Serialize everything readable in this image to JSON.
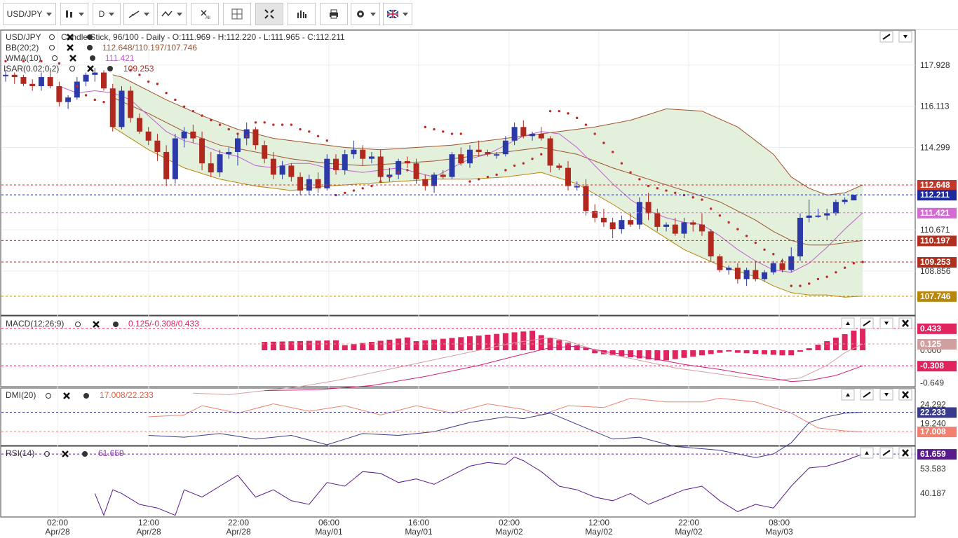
{
  "toolbar": {
    "symbol": "USD/JPY",
    "period": "D",
    "buttons": [
      "chart-type",
      "period",
      "draw",
      "indicators",
      "delete-all",
      "crosshair",
      "fullscreen",
      "studies",
      "print",
      "settings",
      "language"
    ]
  },
  "header": {
    "main": "USD/JPY",
    "main_desc": "Candle Stick, 96/100 - Daily - O:111.969 - H:112.220 - L:111.965 - C:112.211",
    "bb_name": "BB(20;2)",
    "bb_values": "112.648/110.197/107.746",
    "wma_name": "WMA(10)",
    "wma_value": "111.421",
    "sar_name": "ISAR(0.02;0.2)",
    "sar_value": "109.253",
    "macd_name": "MACD(12;26;9)",
    "macd_values": "0.125/-0.308/0.433",
    "dmi_name": "DMI(20)",
    "dmi_values": "17.008/22.233",
    "rsi_name": "RSI(14)",
    "rsi_value": "61.659"
  },
  "price_axis": [
    "117.928",
    "116.113",
    "114.299",
    "110.671",
    "108.856"
  ],
  "price_tags": [
    {
      "label": "112.648",
      "color": "#c0392b",
      "value": 112.648
    },
    {
      "label": "112.211",
      "color": "#1a2a9c",
      "value": 112.211
    },
    {
      "label": "111.421",
      "color": "#d46bd4",
      "value": 111.421
    },
    {
      "label": "110.197",
      "color": "#b03020",
      "value": 110.197
    },
    {
      "label": "109.253",
      "color": "#b03020",
      "value": 109.253
    },
    {
      "label": "107.746",
      "color": "#b8860b",
      "value": 107.746
    }
  ],
  "macd_axis": [
    "0.000",
    "-0.649"
  ],
  "macd_tags": [
    {
      "label": "0.433",
      "color": "#e0245e",
      "value": 0.433
    },
    {
      "label": "0.125",
      "color": "#d0a0a0",
      "value": 0.125
    },
    {
      "label": "-0.308",
      "color": "#e0245e",
      "value": -0.308
    }
  ],
  "dmi_axis": [
    "24.292",
    "19.240"
  ],
  "dmi_tags": [
    {
      "label": "22.233",
      "color": "#3a3a8c",
      "value": 22.233
    },
    {
      "label": "17.008",
      "color": "#f08070",
      "value": 17.008
    }
  ],
  "rsi_axis": [
    "53.583",
    "40.187"
  ],
  "rsi_tags": [
    {
      "label": "61.659",
      "color": "#5a1a8c",
      "value": 61.659
    }
  ],
  "time_axis": [
    {
      "time": "02:00",
      "date": "Apr/28"
    },
    {
      "time": "12:00",
      "date": "Apr/28"
    },
    {
      "time": "22:00",
      "date": "Apr/28"
    },
    {
      "time": "06:00",
      "date": "May/01"
    },
    {
      "time": "16:00",
      "date": "May/01"
    },
    {
      "time": "02:00",
      "date": "May/02"
    },
    {
      "time": "12:00",
      "date": "May/02"
    },
    {
      "time": "22:00",
      "date": "May/02"
    },
    {
      "time": "08:00",
      "date": "May/03"
    }
  ],
  "colors": {
    "bull": "#2b3aa8",
    "bear": "#b0281e",
    "band_fill": "#e3f0dc",
    "band_line": "#a0522d",
    "wma": "#c060d0",
    "sar": "#c0282a",
    "macd_bar": "#e0245e",
    "dmi_plus": "#f08070",
    "dmi_minus": "#3a3a8c",
    "rsi": "#5a1a8c"
  },
  "chart_data": {
    "type": "candlestick",
    "symbol": "USD/JPY",
    "x_labels": [
      "02:00 Apr/28",
      "12:00 Apr/28",
      "22:00 Apr/28",
      "06:00 May/01",
      "16:00 May/01",
      "02:00 May/02",
      "12:00 May/02",
      "22:00 May/02",
      "08:00 May/03"
    ],
    "ylim": [
      107.0,
      119.5
    ],
    "candles": [
      [
        117.5,
        117.7,
        117.2,
        117.5
      ],
      [
        117.5,
        117.6,
        117.1,
        117.4
      ],
      [
        117.4,
        117.5,
        117.0,
        117.1
      ],
      [
        117.1,
        117.3,
        116.8,
        117.0
      ],
      [
        117.0,
        117.6,
        116.8,
        117.4
      ],
      [
        117.4,
        117.8,
        116.9,
        117.0
      ],
      [
        117.0,
        117.2,
        116.1,
        116.3
      ],
      [
        116.3,
        116.6,
        116.0,
        116.5
      ],
      [
        116.5,
        117.4,
        116.4,
        117.2
      ],
      [
        117.2,
        117.6,
        117.0,
        117.5
      ],
      [
        117.5,
        117.8,
        117.2,
        117.6
      ],
      [
        117.6,
        117.7,
        116.8,
        116.9
      ],
      [
        116.9,
        117.1,
        115.0,
        115.2
      ],
      [
        115.2,
        117.0,
        115.1,
        116.8
      ],
      [
        116.8,
        117.0,
        115.4,
        115.6
      ],
      [
        115.6,
        115.8,
        114.9,
        115.0
      ],
      [
        115.0,
        115.2,
        114.4,
        114.6
      ],
      [
        114.6,
        114.9,
        113.7,
        114.1
      ],
      [
        114.1,
        114.4,
        112.6,
        112.9
      ],
      [
        112.9,
        114.9,
        112.7,
        114.7
      ],
      [
        114.7,
        115.2,
        114.3,
        115.0
      ],
      [
        115.0,
        115.3,
        114.5,
        114.7
      ],
      [
        114.7,
        115.0,
        113.3,
        113.6
      ],
      [
        113.6,
        114.1,
        113.0,
        113.2
      ],
      [
        113.2,
        114.2,
        113.0,
        114.0
      ],
      [
        114.0,
        114.3,
        113.8,
        114.1
      ],
      [
        114.1,
        114.9,
        113.5,
        114.7
      ],
      [
        114.7,
        115.4,
        114.4,
        115.1
      ],
      [
        115.1,
        115.2,
        114.2,
        114.4
      ],
      [
        114.4,
        114.6,
        113.6,
        113.8
      ],
      [
        113.8,
        114.1,
        112.9,
        113.1
      ],
      [
        113.1,
        113.7,
        112.9,
        113.5
      ],
      [
        113.5,
        113.6,
        112.8,
        113.0
      ],
      [
        113.0,
        113.2,
        112.2,
        112.4
      ],
      [
        112.4,
        113.1,
        112.2,
        112.9
      ],
      [
        112.9,
        113.2,
        112.3,
        112.5
      ],
      [
        112.5,
        114.0,
        112.4,
        113.8
      ],
      [
        113.8,
        114.0,
        113.1,
        113.3
      ],
      [
        113.3,
        114.2,
        113.1,
        114.0
      ],
      [
        114.0,
        114.6,
        113.8,
        114.2
      ],
      [
        114.2,
        114.4,
        113.5,
        113.8
      ],
      [
        113.8,
        114.1,
        113.6,
        113.9
      ],
      [
        113.9,
        114.2,
        112.8,
        113.0
      ],
      [
        113.0,
        113.4,
        112.8,
        113.1
      ],
      [
        113.1,
        113.8,
        112.9,
        113.7
      ],
      [
        113.7,
        113.9,
        113.4,
        113.6
      ],
      [
        113.6,
        113.8,
        112.7,
        112.9
      ],
      [
        112.9,
        113.1,
        112.4,
        112.6
      ],
      [
        112.6,
        113.2,
        112.3,
        113.1
      ],
      [
        113.1,
        113.3,
        112.9,
        113.0
      ],
      [
        113.0,
        114.1,
        112.9,
        114.0
      ],
      [
        114.0,
        114.3,
        113.5,
        113.6
      ],
      [
        113.6,
        114.4,
        113.4,
        114.2
      ],
      [
        114.2,
        114.6,
        113.9,
        114.1
      ],
      [
        114.1,
        114.2,
        113.9,
        114.0
      ],
      [
        114.0,
        114.1,
        113.8,
        114.0
      ],
      [
        114.0,
        114.8,
        113.9,
        114.6
      ],
      [
        114.6,
        115.4,
        114.4,
        115.2
      ],
      [
        115.2,
        115.5,
        114.7,
        114.8
      ],
      [
        114.8,
        115.0,
        114.6,
        114.9
      ],
      [
        114.9,
        115.2,
        114.6,
        114.7
      ],
      [
        114.7,
        114.8,
        113.2,
        113.5
      ],
      [
        113.5,
        113.6,
        113.3,
        113.4
      ],
      [
        113.4,
        113.7,
        112.4,
        112.6
      ],
      [
        112.6,
        112.8,
        112.4,
        112.6
      ],
      [
        112.6,
        112.9,
        111.3,
        111.5
      ],
      [
        111.5,
        111.8,
        111.0,
        111.2
      ],
      [
        111.2,
        111.6,
        110.8,
        111.0
      ],
      [
        111.0,
        111.2,
        110.3,
        110.7
      ],
      [
        110.7,
        111.3,
        110.5,
        111.1
      ],
      [
        111.1,
        111.4,
        110.8,
        110.9
      ],
      [
        110.9,
        112.1,
        110.7,
        111.9
      ],
      [
        111.9,
        112.3,
        111.1,
        111.4
      ],
      [
        111.4,
        111.6,
        110.6,
        110.8
      ],
      [
        110.8,
        111.0,
        110.6,
        110.9
      ],
      [
        110.9,
        111.2,
        110.4,
        110.5
      ],
      [
        110.5,
        111.2,
        110.3,
        111.0
      ],
      [
        111.0,
        111.1,
        110.6,
        110.9
      ],
      [
        110.9,
        111.4,
        110.4,
        110.6
      ],
      [
        110.6,
        110.7,
        109.3,
        109.5
      ],
      [
        109.5,
        109.6,
        108.8,
        108.9
      ],
      [
        108.9,
        109.1,
        108.7,
        109.0
      ],
      [
        109.0,
        109.2,
        108.3,
        108.5
      ],
      [
        108.5,
        109.0,
        108.2,
        108.9
      ],
      [
        108.9,
        109.3,
        108.4,
        108.5
      ],
      [
        108.5,
        108.9,
        108.4,
        108.8
      ],
      [
        108.8,
        109.3,
        108.7,
        109.2
      ],
      [
        109.2,
        109.4,
        108.8,
        108.9
      ],
      [
        108.9,
        109.9,
        108.8,
        109.5
      ],
      [
        109.5,
        111.4,
        109.3,
        111.2
      ],
      [
        111.2,
        112.0,
        111.0,
        111.3
      ],
      [
        111.3,
        111.6,
        111.2,
        111.3
      ],
      [
        111.3,
        111.6,
        111.1,
        111.4
      ],
      [
        111.4,
        112.0,
        111.3,
        111.9
      ],
      [
        111.9,
        112.1,
        111.8,
        112.0
      ],
      [
        111.969,
        112.22,
        111.965,
        112.211
      ]
    ],
    "bb_upper": [
      [
        12,
        117.5
      ],
      [
        13,
        117.4
      ],
      [
        15,
        117.0
      ],
      [
        18,
        116.4
      ],
      [
        22,
        115.7
      ],
      [
        26,
        115.1
      ],
      [
        30,
        114.7
      ],
      [
        34,
        114.5
      ],
      [
        38,
        114.3
      ],
      [
        42,
        114.2
      ],
      [
        46,
        114.3
      ],
      [
        50,
        114.4
      ],
      [
        54,
        114.6
      ],
      [
        58,
        114.8
      ],
      [
        62,
        115.0
      ],
      [
        66,
        115.2
      ],
      [
        70,
        115.5
      ],
      [
        74,
        116.0
      ],
      [
        78,
        115.9
      ],
      [
        82,
        115.2
      ],
      [
        86,
        114.0
      ],
      [
        88,
        113.0
      ],
      [
        90,
        112.5
      ],
      [
        92,
        112.2
      ],
      [
        94,
        112.3
      ],
      [
        96,
        112.648
      ]
    ],
    "bb_middle": [
      [
        12,
        116.5
      ],
      [
        16,
        115.8
      ],
      [
        20,
        115.0
      ],
      [
        24,
        114.4
      ],
      [
        28,
        114.1
      ],
      [
        32,
        113.8
      ],
      [
        36,
        113.6
      ],
      [
        40,
        113.5
      ],
      [
        44,
        113.6
      ],
      [
        48,
        113.7
      ],
      [
        52,
        113.9
      ],
      [
        56,
        114.1
      ],
      [
        60,
        114.3
      ],
      [
        64,
        114.0
      ],
      [
        68,
        113.4
      ],
      [
        72,
        112.9
      ],
      [
        76,
        112.4
      ],
      [
        80,
        111.9
      ],
      [
        84,
        111.1
      ],
      [
        86,
        110.6
      ],
      [
        88,
        110.2
      ],
      [
        90,
        110.0
      ],
      [
        92,
        110.0
      ],
      [
        94,
        110.1
      ],
      [
        96,
        110.197
      ]
    ],
    "bb_lower": [
      [
        12,
        115.2
      ],
      [
        16,
        114.2
      ],
      [
        20,
        113.4
      ],
      [
        24,
        112.9
      ],
      [
        28,
        112.6
      ],
      [
        32,
        112.4
      ],
      [
        36,
        112.6
      ],
      [
        40,
        112.7
      ],
      [
        44,
        112.8
      ],
      [
        48,
        112.9
      ],
      [
        52,
        112.9
      ],
      [
        56,
        113.0
      ],
      [
        60,
        113.2
      ],
      [
        64,
        112.7
      ],
      [
        68,
        111.8
      ],
      [
        72,
        110.8
      ],
      [
        76,
        109.8
      ],
      [
        80,
        109.1
      ],
      [
        84,
        108.6
      ],
      [
        86,
        108.2
      ],
      [
        88,
        107.9
      ],
      [
        90,
        107.8
      ],
      [
        92,
        107.8
      ],
      [
        94,
        107.7
      ],
      [
        96,
        107.746
      ]
    ],
    "wma": [
      [
        6,
        117.0
      ],
      [
        8,
        116.7
      ],
      [
        10,
        116.8
      ],
      [
        12,
        116.7
      ],
      [
        14,
        116.4
      ],
      [
        16,
        115.7
      ],
      [
        18,
        115.0
      ],
      [
        20,
        114.6
      ],
      [
        22,
        114.4
      ],
      [
        24,
        114.1
      ],
      [
        26,
        113.9
      ],
      [
        28,
        113.5
      ],
      [
        30,
        113.4
      ],
      [
        32,
        113.6
      ],
      [
        34,
        113.6
      ],
      [
        36,
        113.4
      ],
      [
        38,
        113.3
      ],
      [
        40,
        113.2
      ],
      [
        42,
        113.3
      ],
      [
        44,
        113.4
      ],
      [
        46,
        113.2
      ],
      [
        48,
        113.0
      ],
      [
        50,
        113.4
      ],
      [
        52,
        113.8
      ],
      [
        54,
        114.0
      ],
      [
        56,
        114.4
      ],
      [
        58,
        114.8
      ],
      [
        60,
        115.0
      ],
      [
        62,
        114.9
      ],
      [
        64,
        114.3
      ],
      [
        66,
        113.5
      ],
      [
        68,
        112.7
      ],
      [
        70,
        112.0
      ],
      [
        72,
        111.5
      ],
      [
        74,
        111.2
      ],
      [
        76,
        111.0
      ],
      [
        78,
        110.9
      ],
      [
        80,
        110.4
      ],
      [
        82,
        109.8
      ],
      [
        84,
        109.3
      ],
      [
        86,
        108.9
      ],
      [
        88,
        108.8
      ],
      [
        90,
        109.2
      ],
      [
        92,
        109.9
      ],
      [
        94,
        110.7
      ],
      [
        96,
        111.421
      ]
    ],
    "sar": [
      [
        0,
        118.1
      ],
      [
        2,
        118.1
      ],
      [
        4,
        118.1
      ],
      [
        6,
        118.0
      ],
      [
        8,
        117.0
      ],
      [
        9,
        116.6
      ],
      [
        10,
        116.4
      ],
      [
        11,
        116.3
      ],
      [
        14,
        117.7
      ],
      [
        15,
        117.5
      ],
      [
        16,
        117.2
      ],
      [
        17,
        117.1
      ],
      [
        18,
        116.7
      ],
      [
        19,
        116.4
      ],
      [
        20,
        116.1
      ],
      [
        21,
        115.9
      ],
      [
        22,
        115.7
      ],
      [
        23,
        115.5
      ],
      [
        24,
        115.3
      ],
      [
        25,
        115.1
      ],
      [
        26,
        114.9
      ],
      [
        27,
        114.8
      ],
      [
        28,
        115.4
      ],
      [
        29,
        115.4
      ],
      [
        30,
        115.3
      ],
      [
        31,
        115.3
      ],
      [
        32,
        115.3
      ],
      [
        33,
        115.1
      ],
      [
        34,
        115.0
      ],
      [
        35,
        114.8
      ],
      [
        36,
        114.6
      ],
      [
        37,
        112.2
      ],
      [
        38,
        112.3
      ],
      [
        39,
        112.4
      ],
      [
        40,
        112.5
      ],
      [
        41,
        112.6
      ],
      [
        42,
        112.8
      ],
      [
        43,
        113.0
      ],
      [
        44,
        113.2
      ],
      [
        45,
        113.3
      ],
      [
        46,
        113.4
      ],
      [
        47,
        115.2
      ],
      [
        48,
        115.1
      ],
      [
        49,
        115.0
      ],
      [
        50,
        114.9
      ],
      [
        51,
        114.9
      ],
      [
        52,
        112.8
      ],
      [
        53,
        112.9
      ],
      [
        54,
        113.0
      ],
      [
        55,
        113.1
      ],
      [
        56,
        113.3
      ],
      [
        57,
        113.5
      ],
      [
        58,
        113.6
      ],
      [
        59,
        113.8
      ],
      [
        60,
        114.0
      ],
      [
        61,
        115.9
      ],
      [
        62,
        115.9
      ],
      [
        63,
        115.8
      ],
      [
        64,
        115.6
      ],
      [
        65,
        115.3
      ],
      [
        66,
        114.9
      ],
      [
        67,
        114.5
      ],
      [
        68,
        114.1
      ],
      [
        69,
        113.6
      ],
      [
        70,
        113.2
      ],
      [
        71,
        112.9
      ],
      [
        72,
        112.6
      ],
      [
        73,
        112.5
      ],
      [
        74,
        112.4
      ],
      [
        75,
        112.3
      ],
      [
        76,
        112.2
      ],
      [
        77,
        112.1
      ],
      [
        78,
        112.0
      ],
      [
        79,
        111.6
      ],
      [
        80,
        111.3
      ],
      [
        81,
        111.0
      ],
      [
        82,
        110.7
      ],
      [
        83,
        110.4
      ],
      [
        84,
        110.1
      ],
      [
        85,
        109.8
      ],
      [
        86,
        109.6
      ],
      [
        87,
        109.3
      ],
      [
        88,
        108.2
      ],
      [
        89,
        108.2
      ],
      [
        90,
        108.3
      ],
      [
        91,
        108.5
      ],
      [
        92,
        108.6
      ],
      [
        93,
        108.8
      ],
      [
        94,
        109.0
      ],
      [
        95,
        109.2
      ],
      [
        96,
        109.253
      ]
    ]
  }
}
